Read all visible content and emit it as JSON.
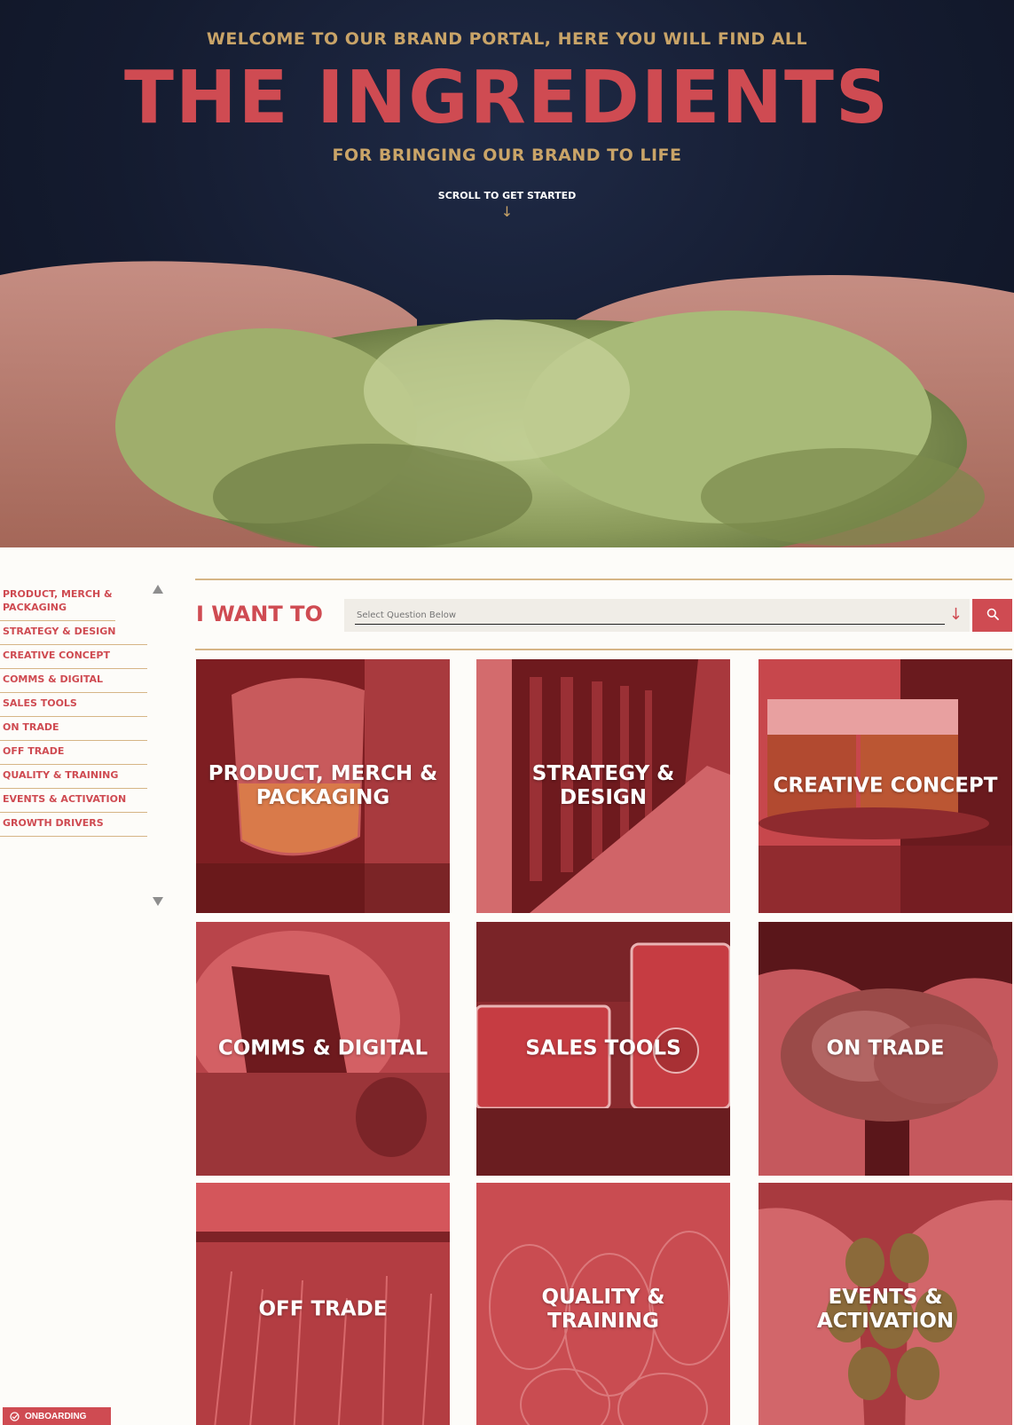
{
  "hero": {
    "kicker": "WELCOME TO OUR BRAND PORTAL, HERE YOU WILL FIND ALL",
    "title": "THE INGREDIENTS",
    "subtitle": "FOR BRINGING OUR BRAND TO LIFE",
    "scroll_hint": "SCROLL TO GET STARTED",
    "scroll_icon": "arrow-down-icon"
  },
  "sidebar": {
    "items": [
      {
        "label": "PRODUCT, MERCH & PACKAGING"
      },
      {
        "label": "STRATEGY & DESIGN"
      },
      {
        "label": "CREATIVE CONCEPT"
      },
      {
        "label": "COMMS & DIGITAL"
      },
      {
        "label": "SALES TOOLS"
      },
      {
        "label": "ON TRADE"
      },
      {
        "label": "OFF TRADE"
      },
      {
        "label": "QUALITY & TRAINING"
      },
      {
        "label": "EVENTS & ACTIVATION"
      },
      {
        "label": "GROWTH DRIVERS"
      }
    ]
  },
  "question": {
    "label": "I WANT TO",
    "placeholder": "Select Question Below",
    "dropdown_icon": "arrow-down-icon",
    "search_icon": "search-icon"
  },
  "tiles": [
    {
      "label": "PRODUCT, MERCH & PACKAGING"
    },
    {
      "label": "STRATEGY & DESIGN"
    },
    {
      "label": "CREATIVE CONCEPT"
    },
    {
      "label": "COMMS & DIGITAL"
    },
    {
      "label": "SALES TOOLS"
    },
    {
      "label": "ON TRADE"
    },
    {
      "label": "OFF TRADE"
    },
    {
      "label": "QUALITY & TRAINING"
    },
    {
      "label": "EVENTS & ACTIVATION"
    }
  ],
  "onboarding": {
    "label": "ONBOARDING",
    "icon": "check-circle-icon"
  },
  "colors": {
    "brand_red": "#cf4b52",
    "gold": "#c9a468",
    "navy": "#141b2f",
    "cream": "#fdfcf9"
  }
}
